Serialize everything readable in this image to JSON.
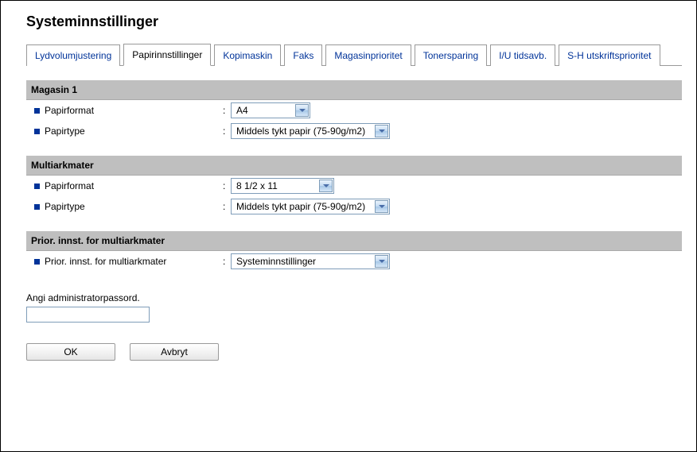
{
  "page": {
    "title": "Systeminnstillinger"
  },
  "tabs": [
    {
      "label": "Lydvolumjustering",
      "active": false
    },
    {
      "label": "Papirinnstillinger",
      "active": true
    },
    {
      "label": "Kopimaskin",
      "active": false
    },
    {
      "label": "Faks",
      "active": false
    },
    {
      "label": "Magasinprioritet",
      "active": false
    },
    {
      "label": "Tonersparing",
      "active": false
    },
    {
      "label": "I/U tidsavb.",
      "active": false
    },
    {
      "label": "S-H utskriftsprioritet",
      "active": false
    }
  ],
  "sections": {
    "tray1": {
      "header": "Magasin 1",
      "paper_size_label": "Papirformat",
      "paper_size_value": "A4",
      "paper_type_label": "Papirtype",
      "paper_type_value": "Middels tykt papir (75-90g/m2)"
    },
    "bypass": {
      "header": "Multiarkmater",
      "paper_size_label": "Papirformat",
      "paper_size_value": "8 1/2 x 11",
      "paper_type_label": "Papirtype",
      "paper_type_value": "Middels tykt papir (75-90g/m2)"
    },
    "bypass_priority": {
      "header": "Prior. innst. for multiarkmater",
      "field_label": "Prior. innst. for multiarkmater",
      "field_value": "Systeminnstillinger"
    }
  },
  "password": {
    "label": "Angi administratorpassord.",
    "value": ""
  },
  "buttons": {
    "ok": "OK",
    "cancel": "Avbryt"
  }
}
